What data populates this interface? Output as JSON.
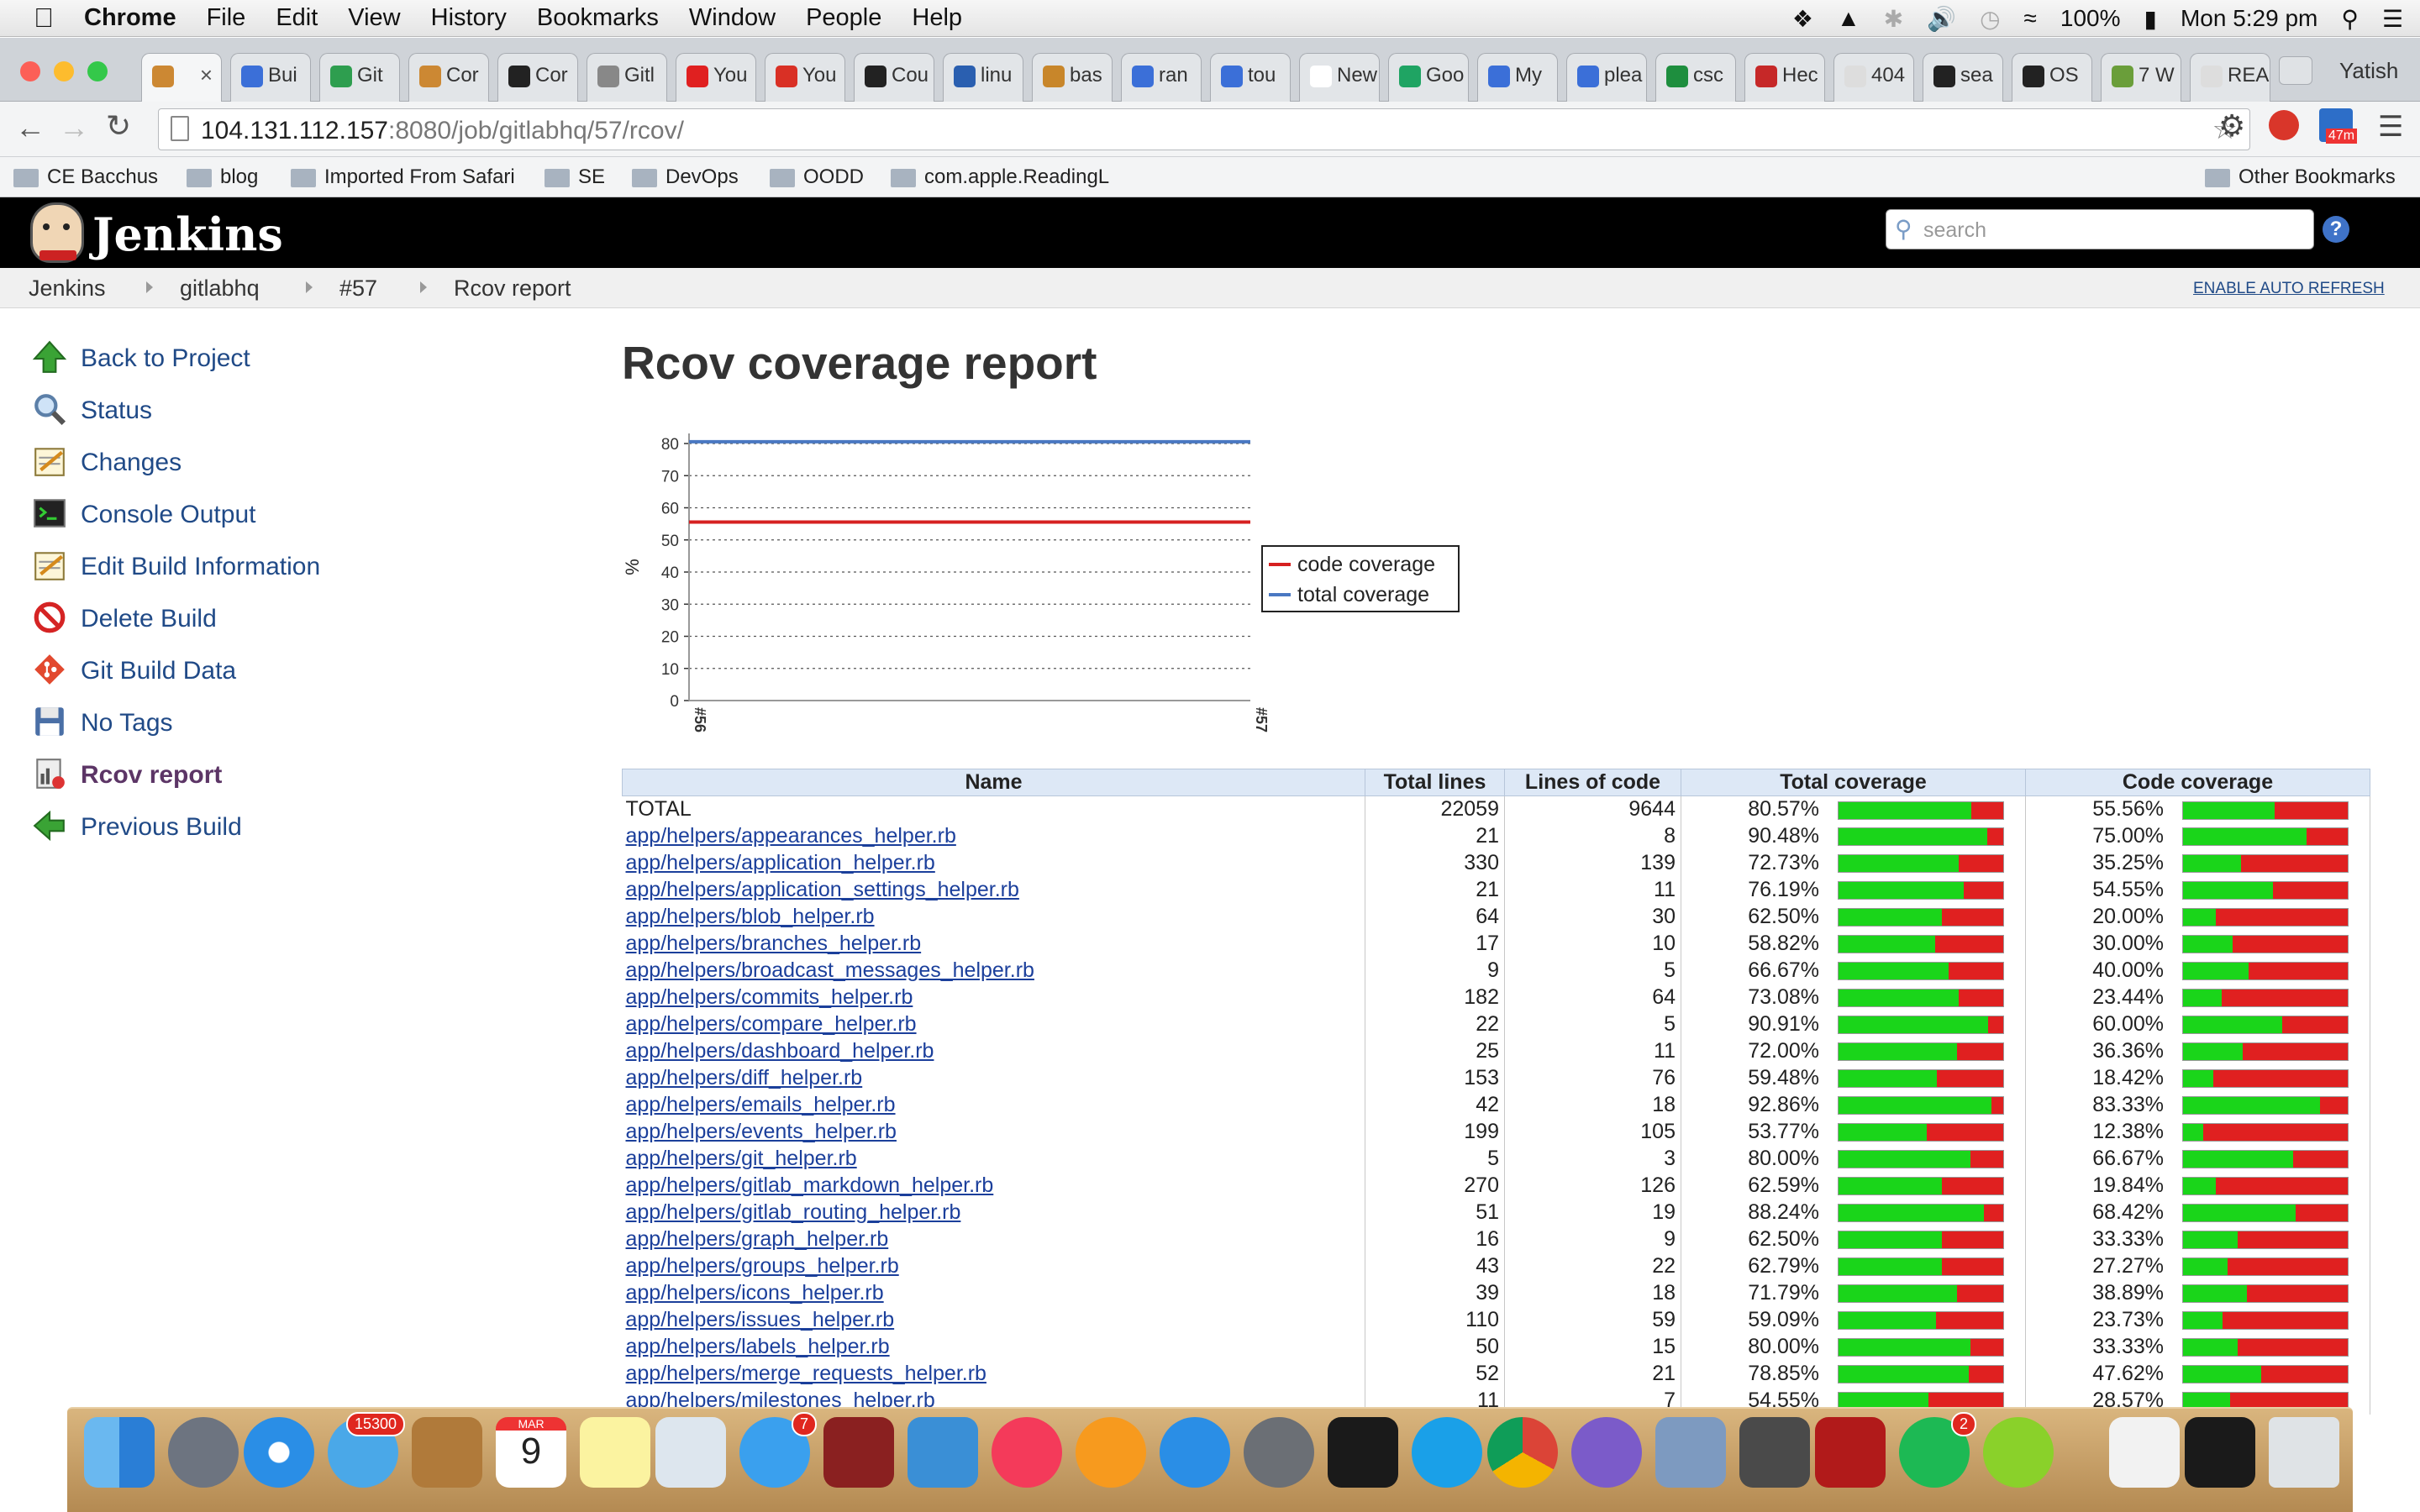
{
  "menubar": {
    "app": "Chrome",
    "items": [
      "File",
      "Edit",
      "View",
      "History",
      "Bookmarks",
      "Window",
      "People",
      "Help"
    ],
    "battery": "100%",
    "clock": "Mon 5:29 pm"
  },
  "browser": {
    "profile": "Yatish",
    "tabs": [
      "",
      "Bui",
      "Git",
      "Cor",
      "Cor",
      "Gitl",
      "You",
      "You",
      "Cou",
      "linu",
      "bas",
      "ran",
      "tou",
      "New T",
      "Goo",
      "My",
      "plea",
      "csc",
      "Hec",
      "404",
      "sea",
      "OS",
      "7 W",
      "REA"
    ],
    "url_host": "104.131.112.157",
    "url_rest": ":8080/job/gitlabhq/57/rcov/",
    "ext_badge": "47m"
  },
  "bookmarks": {
    "items": [
      "CE Bacchus",
      "blog",
      "Imported From Safari",
      "SE",
      "DevOps",
      "OODD",
      "com.apple.ReadingL"
    ],
    "other": "Other Bookmarks"
  },
  "jenkins": {
    "brand": "Jenkins",
    "search_placeholder": "search",
    "crumbs": [
      "Jenkins",
      "gitlabhq",
      "#57",
      "Rcov report"
    ],
    "auto_refresh": "ENABLE AUTO REFRESH",
    "tasks": [
      "Back to Project",
      "Status",
      "Changes",
      "Console Output",
      "Edit Build Information",
      "Delete Build",
      "Git Build Data",
      "No Tags",
      "Rcov report",
      "Previous Build"
    ],
    "page_title": "Rcov coverage report"
  },
  "chart_data": {
    "type": "line",
    "title": "",
    "xlabel": "",
    "ylabel": "%",
    "x": [
      "#56",
      "#57"
    ],
    "ylim": [
      0,
      80
    ],
    "yticks": [
      0,
      10,
      20,
      30,
      40,
      50,
      60,
      70,
      80
    ],
    "grid": true,
    "legend_position": "right",
    "series": [
      {
        "name": "code coverage",
        "color": "#d62020",
        "values": [
          55.56,
          55.56
        ]
      },
      {
        "name": "total coverage",
        "color": "#4a78c2",
        "values": [
          80.57,
          80.57
        ]
      }
    ]
  },
  "table": {
    "headers": [
      "Name",
      "Total lines",
      "Lines of code",
      "Total coverage",
      "Code coverage"
    ],
    "rows": [
      {
        "name": "TOTAL",
        "total": "22059",
        "loc": "9644",
        "tc": "80.57%",
        "cc": "55.56%",
        "link": false
      },
      {
        "name": "app/helpers/appearances_helper.rb",
        "total": "21",
        "loc": "8",
        "tc": "90.48%",
        "cc": "75.00%",
        "link": true
      },
      {
        "name": "app/helpers/application_helper.rb",
        "total": "330",
        "loc": "139",
        "tc": "72.73%",
        "cc": "35.25%",
        "link": true
      },
      {
        "name": "app/helpers/application_settings_helper.rb",
        "total": "21",
        "loc": "11",
        "tc": "76.19%",
        "cc": "54.55%",
        "link": true
      },
      {
        "name": "app/helpers/blob_helper.rb",
        "total": "64",
        "loc": "30",
        "tc": "62.50%",
        "cc": "20.00%",
        "link": true
      },
      {
        "name": "app/helpers/branches_helper.rb",
        "total": "17",
        "loc": "10",
        "tc": "58.82%",
        "cc": "30.00%",
        "link": true
      },
      {
        "name": "app/helpers/broadcast_messages_helper.rb",
        "total": "9",
        "loc": "5",
        "tc": "66.67%",
        "cc": "40.00%",
        "link": true
      },
      {
        "name": "app/helpers/commits_helper.rb",
        "total": "182",
        "loc": "64",
        "tc": "73.08%",
        "cc": "23.44%",
        "link": true
      },
      {
        "name": "app/helpers/compare_helper.rb",
        "total": "22",
        "loc": "5",
        "tc": "90.91%",
        "cc": "60.00%",
        "link": true
      },
      {
        "name": "app/helpers/dashboard_helper.rb",
        "total": "25",
        "loc": "11",
        "tc": "72.00%",
        "cc": "36.36%",
        "link": true
      },
      {
        "name": "app/helpers/diff_helper.rb",
        "total": "153",
        "loc": "76",
        "tc": "59.48%",
        "cc": "18.42%",
        "link": true
      },
      {
        "name": "app/helpers/emails_helper.rb",
        "total": "42",
        "loc": "18",
        "tc": "92.86%",
        "cc": "83.33%",
        "link": true
      },
      {
        "name": "app/helpers/events_helper.rb",
        "total": "199",
        "loc": "105",
        "tc": "53.77%",
        "cc": "12.38%",
        "link": true
      },
      {
        "name": "app/helpers/git_helper.rb",
        "total": "5",
        "loc": "3",
        "tc": "80.00%",
        "cc": "66.67%",
        "link": true
      },
      {
        "name": "app/helpers/gitlab_markdown_helper.rb",
        "total": "270",
        "loc": "126",
        "tc": "62.59%",
        "cc": "19.84%",
        "link": true
      },
      {
        "name": "app/helpers/gitlab_routing_helper.rb",
        "total": "51",
        "loc": "19",
        "tc": "88.24%",
        "cc": "68.42%",
        "link": true
      },
      {
        "name": "app/helpers/graph_helper.rb",
        "total": "16",
        "loc": "9",
        "tc": "62.50%",
        "cc": "33.33%",
        "link": true
      },
      {
        "name": "app/helpers/groups_helper.rb",
        "total": "43",
        "loc": "22",
        "tc": "62.79%",
        "cc": "27.27%",
        "link": true
      },
      {
        "name": "app/helpers/icons_helper.rb",
        "total": "39",
        "loc": "18",
        "tc": "71.79%",
        "cc": "38.89%",
        "link": true
      },
      {
        "name": "app/helpers/issues_helper.rb",
        "total": "110",
        "loc": "59",
        "tc": "59.09%",
        "cc": "23.73%",
        "link": true
      },
      {
        "name": "app/helpers/labels_helper.rb",
        "total": "50",
        "loc": "15",
        "tc": "80.00%",
        "cc": "33.33%",
        "link": true
      },
      {
        "name": "app/helpers/merge_requests_helper.rb",
        "total": "52",
        "loc": "21",
        "tc": "78.85%",
        "cc": "47.62%",
        "link": true
      },
      {
        "name": "app/helpers/milestones_helper.rb",
        "total": "11",
        "loc": "7",
        "tc": "54.55%",
        "cc": "28.57%",
        "link": true
      }
    ]
  },
  "dock": {
    "badges": {
      "appstore_updates": "15300",
      "messages": "7",
      "spotify": "2"
    },
    "calendar_month": "MAR",
    "calendar_day": "9"
  }
}
